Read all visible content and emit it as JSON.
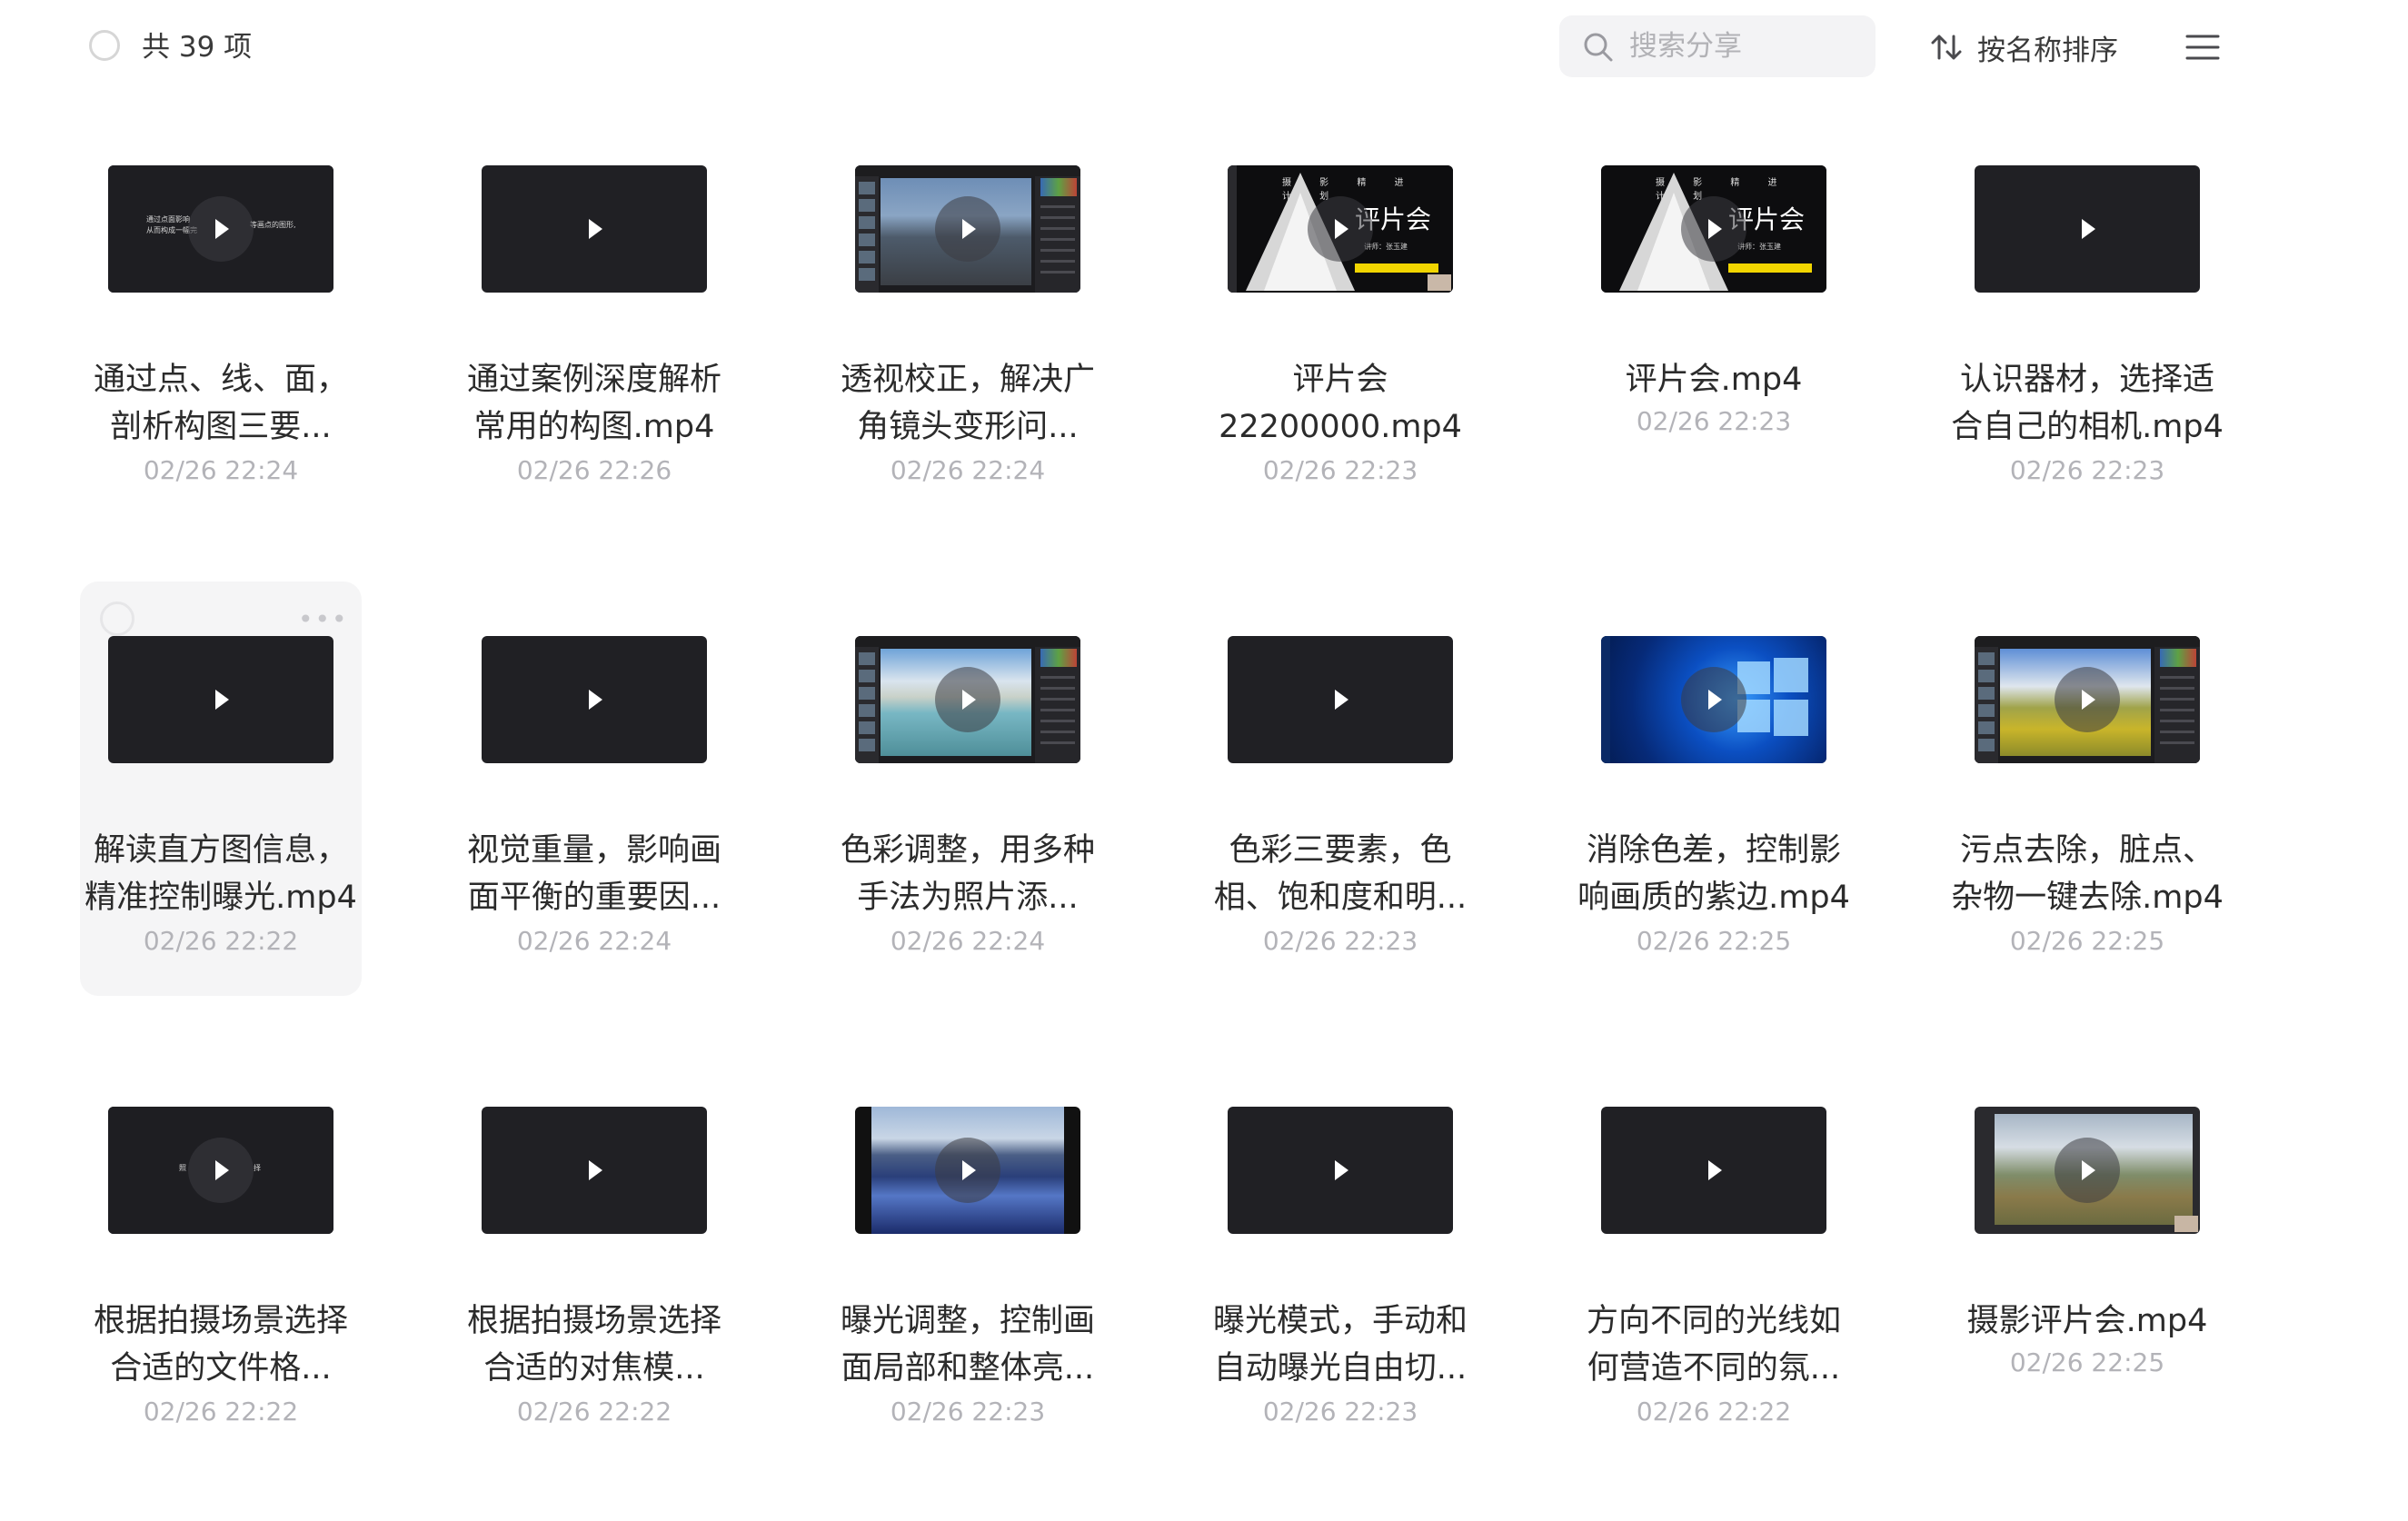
{
  "header": {
    "total_label": "共 39 项",
    "search_placeholder": "搜索分享",
    "sort_label": "按名称排序"
  },
  "files": [
    {
      "title": "通过点、线、面，\n剖析构图三要...",
      "date": "02/26 22:24",
      "thumb": "text"
    },
    {
      "title": "通过案例深度解析\n常用的构图.mp4",
      "date": "02/26 22:26",
      "thumb": "dark"
    },
    {
      "title": "透视校正，解决广\n角镜头变形问...",
      "date": "02/26 22:24",
      "thumb": "lr-city"
    },
    {
      "title": "评片会\n22200000.mp4",
      "date": "02/26 22:23",
      "thumb": "triangle-a"
    },
    {
      "title": "评片会.mp4",
      "date": "02/26 22:23",
      "thumb": "triangle-b"
    },
    {
      "title": "认识器材，选择适\n合自己的相机.mp4",
      "date": "02/26 22:23",
      "thumb": "dark"
    },
    {
      "title": "解读直方图信息，\n精准控制曝光.mp4",
      "date": "02/26 22:22",
      "thumb": "dark",
      "hover": true
    },
    {
      "title": "视觉重量，影响画\n面平衡的重要因...",
      "date": "02/26 22:24",
      "thumb": "dark"
    },
    {
      "title": "色彩调整，用多种\n手法为照片添...",
      "date": "02/26 22:24",
      "thumb": "lr-lake"
    },
    {
      "title": "色彩三要素，色\n相、饱和度和明...",
      "date": "02/26 22:23",
      "thumb": "dark"
    },
    {
      "title": "消除色差，控制影\n响画质的紫边.mp4",
      "date": "02/26 22:25",
      "thumb": "win"
    },
    {
      "title": "污点去除，脏点、\n杂物一键去除.mp4",
      "date": "02/26 22:25",
      "thumb": "lr-field"
    },
    {
      "title": "根据拍摄场景选择\n合适的文件格...",
      "date": "02/26 22:22",
      "thumb": "text2"
    },
    {
      "title": "根据拍摄场景选择\n合适的对焦模...",
      "date": "02/26 22:22",
      "thumb": "dark"
    },
    {
      "title": "曝光调整，控制画\n面局部和整体亮...",
      "date": "02/26 22:23",
      "thumb": "water"
    },
    {
      "title": "曝光模式，手动和\n自动曝光自由切...",
      "date": "02/26 22:23",
      "thumb": "dark"
    },
    {
      "title": "方向不同的光线如\n何营造不同的氛...",
      "date": "02/26 22:22",
      "thumb": "dark"
    },
    {
      "title": "摄影评片会.mp4",
      "date": "02/26 22:25",
      "thumb": "hills"
    }
  ],
  "thumb_text": {
    "t1_left": "通过点面影响\n从而构成一幅完",
    "t1_right": "等画点的图形,",
    "t2_left": "照",
    "t2_right": "择",
    "triangle_title": "评片会",
    "triangle_sub": "讲师：张玉建",
    "triangle_dots": "摄 影 精 进 计 划"
  },
  "colors": {
    "card_hover_bg": "#f5f5f6",
    "thumb_bg": "#202024",
    "date_color": "#b3b3b8"
  }
}
